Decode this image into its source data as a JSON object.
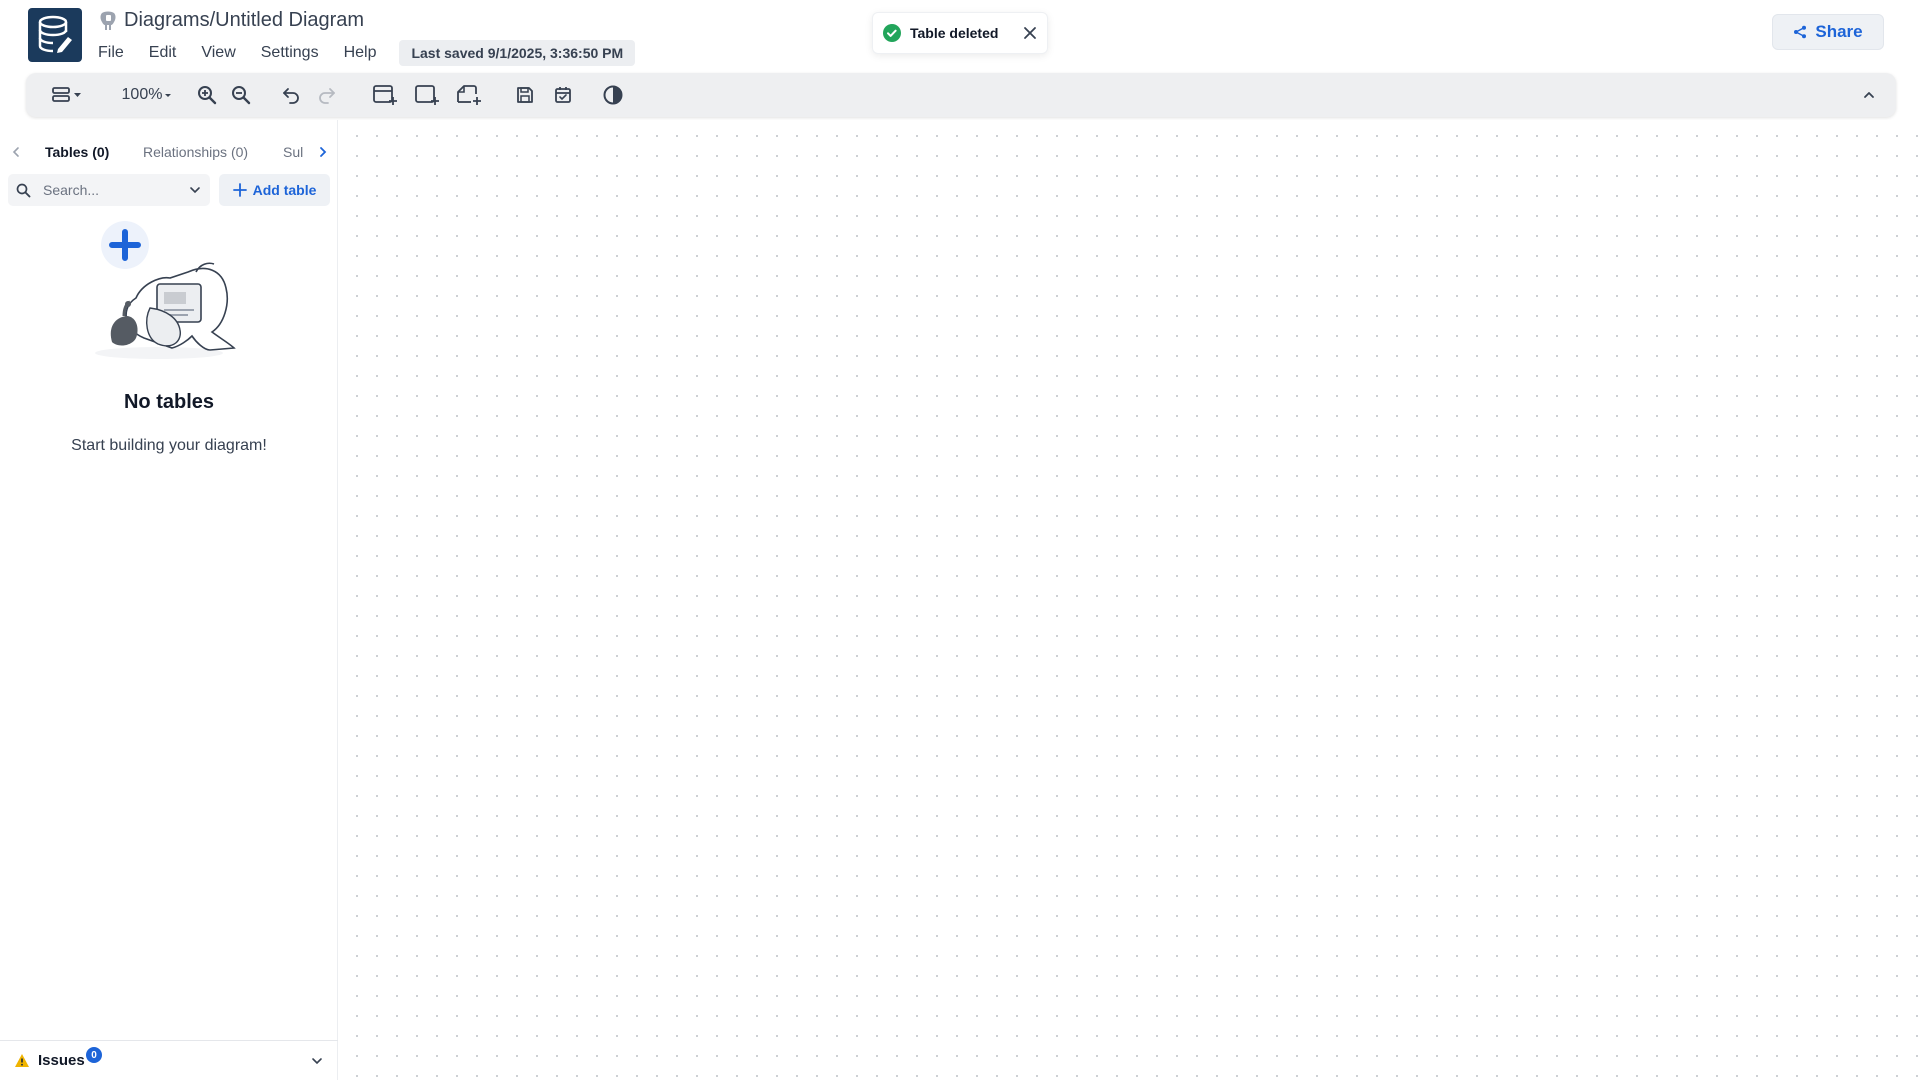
{
  "header": {
    "title": "Diagrams/Untitled Diagram",
    "menu": [
      "File",
      "Edit",
      "View",
      "Settings",
      "Help"
    ],
    "last_saved": "Last saved 9/1/2025, 3:36:50 PM",
    "share_label": "Share"
  },
  "toast": {
    "message": "Table deleted"
  },
  "toolbar": {
    "zoom": "100%"
  },
  "sidebar": {
    "tabs": [
      {
        "label": "Tables (0)",
        "active": true
      },
      {
        "label": "Relationships (0)",
        "active": false
      },
      {
        "label": "Sul",
        "active": false
      }
    ],
    "search_placeholder": "Search...",
    "add_table_label": "Add table",
    "empty_title": "No tables",
    "empty_subtitle": "Start building your diagram!",
    "issues_label": "Issues",
    "issues_count": "0"
  },
  "colors": {
    "accent": "#1d64d8",
    "logo_bg": "#1b3a5c",
    "success": "#22a55b",
    "warning": "#f0b400"
  }
}
